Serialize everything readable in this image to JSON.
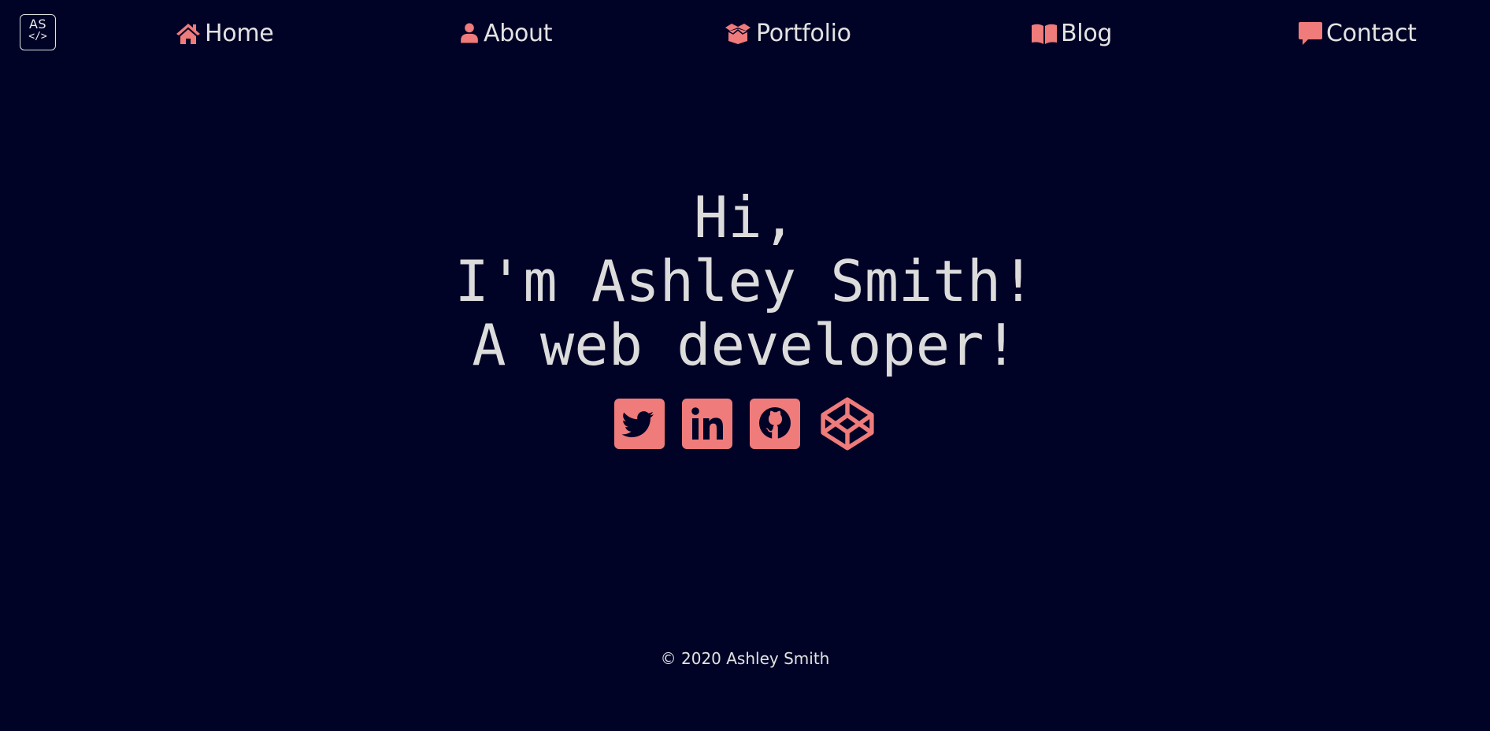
{
  "logo": {
    "line1": "AS",
    "line2": "</>"
  },
  "nav": {
    "items": [
      {
        "label": "Home",
        "icon": "home-icon"
      },
      {
        "label": "About",
        "icon": "user-icon"
      },
      {
        "label": "Portfolio",
        "icon": "box-open-icon"
      },
      {
        "label": "Blog",
        "icon": "book-open-icon"
      },
      {
        "label": "Contact",
        "icon": "comment-icon"
      }
    ]
  },
  "hero": {
    "line1": "Hi,",
    "line2": "I'm Ashley Smith!",
    "line3": "A web developer!"
  },
  "socials": [
    "twitter-icon",
    "linkedin-icon",
    "github-icon",
    "codepen-icon"
  ],
  "footer": {
    "text": "© 2020 Ashley Smith"
  },
  "colors": {
    "background": "#000326",
    "accent": "#ef7b7b",
    "text": "#dedede"
  }
}
